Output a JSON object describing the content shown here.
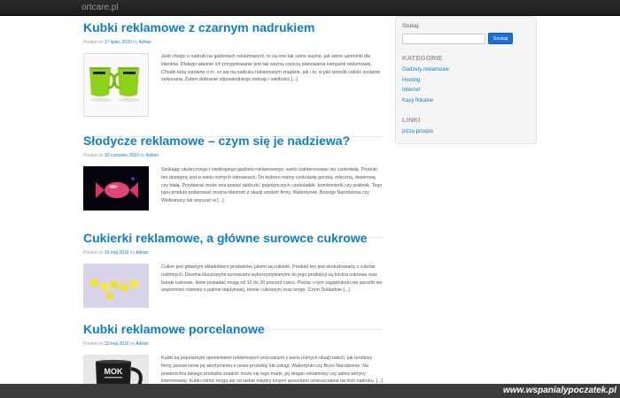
{
  "site": {
    "brand": "ortcare.pl"
  },
  "posts": [
    {
      "title": "Kubki reklamowe z czarnym nadrukiem",
      "meta_prefix": "Posted on",
      "date": "17 lipiec 2020",
      "by": "by",
      "author": "Adrian",
      "image_alt": "mugs-image",
      "excerpt": "Jeśli chodzi o nadruki na gadżetach reklamowych, to są one tak samo ważne, jak same upominki dla klientów. Dlatego właśnie ich przygotowanie jest tak ważną częścią planowania kampanii reklamowej. Chodzi tutaj zarówno o to, co się na nadruku reklamowym znajdzie, jak i to, w jaki sposób całość zostanie wykonana. Zatem dobranie odpowiedniego rodzaju i wielkości [...]"
    },
    {
      "title": "Słodycze reklamowe – czym się je nadziewa?",
      "meta_prefix": "Posted on",
      "date": "30 czerwiec 2019",
      "by": "by",
      "author": "Adrian",
      "excerpt": "Szukając skutecznego i niedrogiego gadżetu reklamowego, warto zainteresować się czekoladą. Produkt ten dostępny jest w wielu różnych odmianach. Do wyboru mamy czekoladę gorzką, mleczną, deserową czy białą. Przybierać może ona postać tabliczki, pojedynczych czekoladek, bombonierki czy pralinek. Tego typu produkt podarować można klientom z okazji urodzin firmy, Walentynek, Bożego Narodzenia czy Wielkanocy lub wręczać w [...]"
    },
    {
      "title": "Cukierki reklamowe, a główne surowce cukrowe",
      "meta_prefix": "Posted on",
      "date": "26 maj 2019",
      "by": "by",
      "author": "Adrian",
      "excerpt": "Cukier jest głównym składnikiem produktów, jakimi są cukierki. Produkt ten jest ekstrahowany z cukrów roślinnych. Dwoma kluczowymi surowcami wykorzystywanymi do jego produkcji są trzcina cukrowa oraz buraki cukrowe, które posiadać mogą od 12 do 20 procent cukru. Pisząc o tym zagadnieniu nie sposób nie wspomnieć również o palmie daktylowej, klonie cukrowym oraz sorgo. Czym Dokładnie [...]"
    },
    {
      "title": "Kubki reklamowe porcelanowe",
      "meta_prefix": "Posted on",
      "date": "20 maj 2019",
      "by": "by",
      "author": "Adrian",
      "excerpt": "Kubki są popularnym upominkiem reklamowym wręczanym z wielu różnych okazji takich, jak urodziny firmy, poszerzenie jej asortymentu o nowe produkty lub usługi, Walentynki czy Boże Narodzenie. Na powierzchni takiego produktu znaleźć może się logo marki, jej slogan reklamowy czy adres witryny internetowej. Kubki różnić mogą się od siebie między innymi sposobem umieszczania na nich nadruku, [...]",
      "mug_text": "MOK"
    }
  ],
  "sidebar": {
    "search_label": "Szukaj:",
    "search_value": "",
    "search_button": "Szukaj",
    "categories_title": "KATEGORIE",
    "categories": [
      "Gadżety reklamowe",
      "Hosting",
      "Internet",
      "Kasy fiskalne"
    ],
    "links_title": "LINKI",
    "links": [
      "pizza przepis"
    ]
  },
  "watermark": "www.wspanialypoczatek.pl",
  "colors": {
    "link": "#0e7fc4",
    "topbar": "#1b1b1b",
    "button": "#1d6ed8"
  }
}
